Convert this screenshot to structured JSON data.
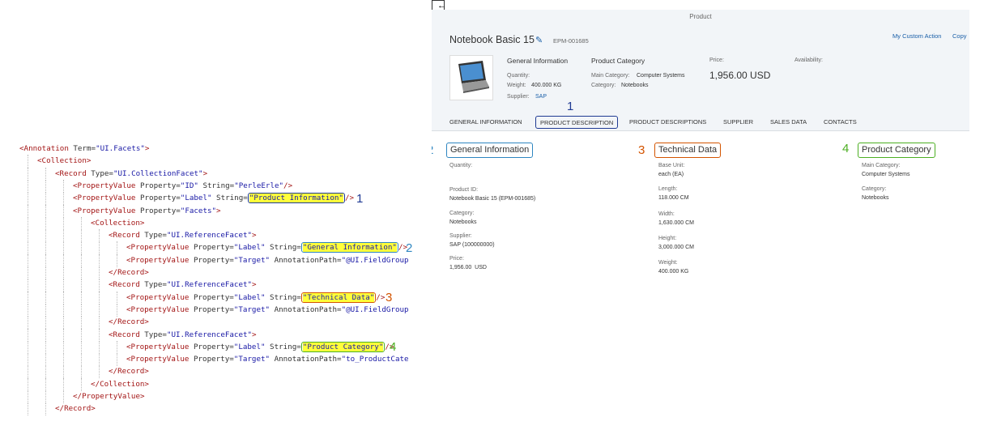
{
  "code": {
    "lines": [
      {
        "indent": 0,
        "tokens": [
          [
            "tag",
            "<Annotation "
          ],
          [
            "attr",
            "Term="
          ],
          [
            "str",
            "\"UI.Facets\""
          ],
          [
            "tag",
            ">"
          ]
        ]
      },
      {
        "indent": 1,
        "tokens": [
          [
            "tag",
            "<Collection>"
          ]
        ]
      },
      {
        "indent": 2,
        "tokens": [
          [
            "tag",
            "<Record "
          ],
          [
            "attr",
            "Type="
          ],
          [
            "str",
            "\"UI.CollectionFacet\""
          ],
          [
            "tag",
            ">"
          ]
        ]
      },
      {
        "indent": 3,
        "tokens": [
          [
            "tag",
            "<PropertyValue "
          ],
          [
            "attr",
            "Property="
          ],
          [
            "str",
            "\"ID\" "
          ],
          [
            "attr",
            "String="
          ],
          [
            "str",
            "\"PerleErle\""
          ],
          [
            "tag",
            "/>"
          ]
        ]
      },
      {
        "indent": 3,
        "tokens": [
          [
            "tag",
            "<PropertyValue "
          ],
          [
            "attr",
            "Property="
          ],
          [
            "str",
            "\"Label\" "
          ],
          [
            "attr",
            "String="
          ],
          [
            "box1",
            "\"Product Information\""
          ],
          [
            "tag",
            "/>"
          ]
        ],
        "marker": "1"
      },
      {
        "indent": 3,
        "tokens": [
          [
            "tag",
            "<PropertyValue "
          ],
          [
            "attr",
            "Property="
          ],
          [
            "str",
            "\"Facets\""
          ],
          [
            "tag",
            ">"
          ]
        ]
      },
      {
        "indent": 4,
        "tokens": [
          [
            "tag",
            "<Collection>"
          ]
        ]
      },
      {
        "indent": 5,
        "tokens": [
          [
            "tag",
            "<Record "
          ],
          [
            "attr",
            "Type="
          ],
          [
            "str",
            "\"UI.ReferenceFacet\""
          ],
          [
            "tag",
            ">"
          ]
        ]
      },
      {
        "indent": 6,
        "tokens": [
          [
            "tag",
            "<PropertyValue "
          ],
          [
            "attr",
            "Property="
          ],
          [
            "str",
            "\"Label\" "
          ],
          [
            "attr",
            "String="
          ],
          [
            "box2",
            "\"General Information\""
          ],
          [
            "tag",
            "/>"
          ]
        ],
        "marker": "2"
      },
      {
        "indent": 6,
        "tokens": [
          [
            "tag",
            "<PropertyValue "
          ],
          [
            "attr",
            "Property="
          ],
          [
            "str",
            "\"Target\" "
          ],
          [
            "attr",
            "AnnotationPath="
          ],
          [
            "str",
            "\"@UI.FieldGroup"
          ]
        ]
      },
      {
        "indent": 5,
        "tokens": [
          [
            "tag",
            "</Record>"
          ]
        ]
      },
      {
        "indent": 5,
        "tokens": [
          [
            "tag",
            "<Record "
          ],
          [
            "attr",
            "Type="
          ],
          [
            "str",
            "\"UI.ReferenceFacet\""
          ],
          [
            "tag",
            ">"
          ]
        ]
      },
      {
        "indent": 6,
        "tokens": [
          [
            "tag",
            "<PropertyValue "
          ],
          [
            "attr",
            "Property="
          ],
          [
            "str",
            "\"Label\" "
          ],
          [
            "attr",
            "String="
          ],
          [
            "box3",
            "\"Technical Data\""
          ],
          [
            "tag",
            "/>"
          ]
        ],
        "marker": "3"
      },
      {
        "indent": 6,
        "tokens": [
          [
            "tag",
            "<PropertyValue "
          ],
          [
            "attr",
            "Property="
          ],
          [
            "str",
            "\"Target\" "
          ],
          [
            "attr",
            "AnnotationPath="
          ],
          [
            "str",
            "\"@UI.FieldGroup"
          ]
        ]
      },
      {
        "indent": 5,
        "tokens": [
          [
            "tag",
            "</Record>"
          ]
        ]
      },
      {
        "indent": 5,
        "tokens": [
          [
            "tag",
            "<Record "
          ],
          [
            "attr",
            "Type="
          ],
          [
            "str",
            "\"UI.ReferenceFacet\""
          ],
          [
            "tag",
            ">"
          ]
        ]
      },
      {
        "indent": 6,
        "tokens": [
          [
            "tag",
            "<PropertyValue "
          ],
          [
            "attr",
            "Property="
          ],
          [
            "str",
            "\"Label\" "
          ],
          [
            "attr",
            "String="
          ],
          [
            "box4",
            "\"Product Category\""
          ],
          [
            "tag",
            "/>"
          ]
        ],
        "marker": "4"
      },
      {
        "indent": 6,
        "tokens": [
          [
            "tag",
            "<PropertyValue "
          ],
          [
            "attr",
            "Property="
          ],
          [
            "str",
            "\"Target\" "
          ],
          [
            "attr",
            "AnnotationPath="
          ],
          [
            "str",
            "\"to_ProductCate"
          ]
        ]
      },
      {
        "indent": 5,
        "tokens": [
          [
            "tag",
            "</Record>"
          ]
        ]
      },
      {
        "indent": 4,
        "tokens": [
          [
            "tag",
            "</Collection>"
          ]
        ]
      },
      {
        "indent": 3,
        "tokens": [
          [
            "tag",
            "</PropertyValue>"
          ]
        ]
      },
      {
        "indent": 2,
        "tokens": [
          [
            "tag",
            "</Record>"
          ]
        ]
      }
    ]
  },
  "markers": {
    "m1": "1",
    "m2": "2",
    "m3": "3",
    "m4": "4"
  },
  "colors": {
    "marker1": "#1f3a93",
    "marker2": "#2e86c1",
    "marker3": "#d35400",
    "marker4": "#4caf22"
  },
  "app": {
    "page_label": "Product",
    "title": "Notebook Basic 15",
    "object_id": "EPM-001685",
    "actions": {
      "custom": "My Custom Action",
      "copy": "Copy"
    },
    "header": {
      "general_title": "General Information",
      "quantity_label": "Quantity:",
      "weight_label": "Weight:",
      "weight_value": "400.000 KG",
      "supplier_label": "Supplier:",
      "supplier_value": "SAP",
      "category_title": "Product Category",
      "main_category_label": "Main Category:",
      "main_category_value": "Computer Systems",
      "category_label": "Category:",
      "category_value": "Notebooks",
      "price_label": "Price:",
      "price_value": "1,956.00  USD",
      "availability_label": "Availability:"
    },
    "tabs": [
      "GENERAL INFORMATION",
      "PRODUCT DESCRIPTION",
      "PRODUCT DESCRIPTIONS",
      "SUPPLIER",
      "SALES DATA",
      "CONTACTS"
    ],
    "sections": {
      "general": {
        "title": "General Information",
        "quantity_label": "Quantity:",
        "product_id_label": "Product ID:",
        "product_id_value": "Notebook Basic 15 (EPM-001685)",
        "category_label": "Category:",
        "category_value": "Notebooks",
        "supplier_label": "Supplier:",
        "supplier_value": "SAP (100000000)",
        "price_label": "Price:",
        "price_value": "1,956.00  USD"
      },
      "technical": {
        "title": "Technical Data",
        "base_unit_label": "Base Unit:",
        "base_unit_value": "each (EA)",
        "length_label": "Length:",
        "length_value": "118.000 CM",
        "width_label": "Width:",
        "width_value": "1,630.000 CM",
        "height_label": "Height:",
        "height_value": "3,000.000 CM",
        "weight_label": "Weight:",
        "weight_value": "400.000 KG"
      },
      "category": {
        "title": "Product Category",
        "main_category_label": "Main Category:",
        "main_category_value": "Computer Systems",
        "category_label": "Category:",
        "category_value": "Notebooks"
      }
    }
  }
}
